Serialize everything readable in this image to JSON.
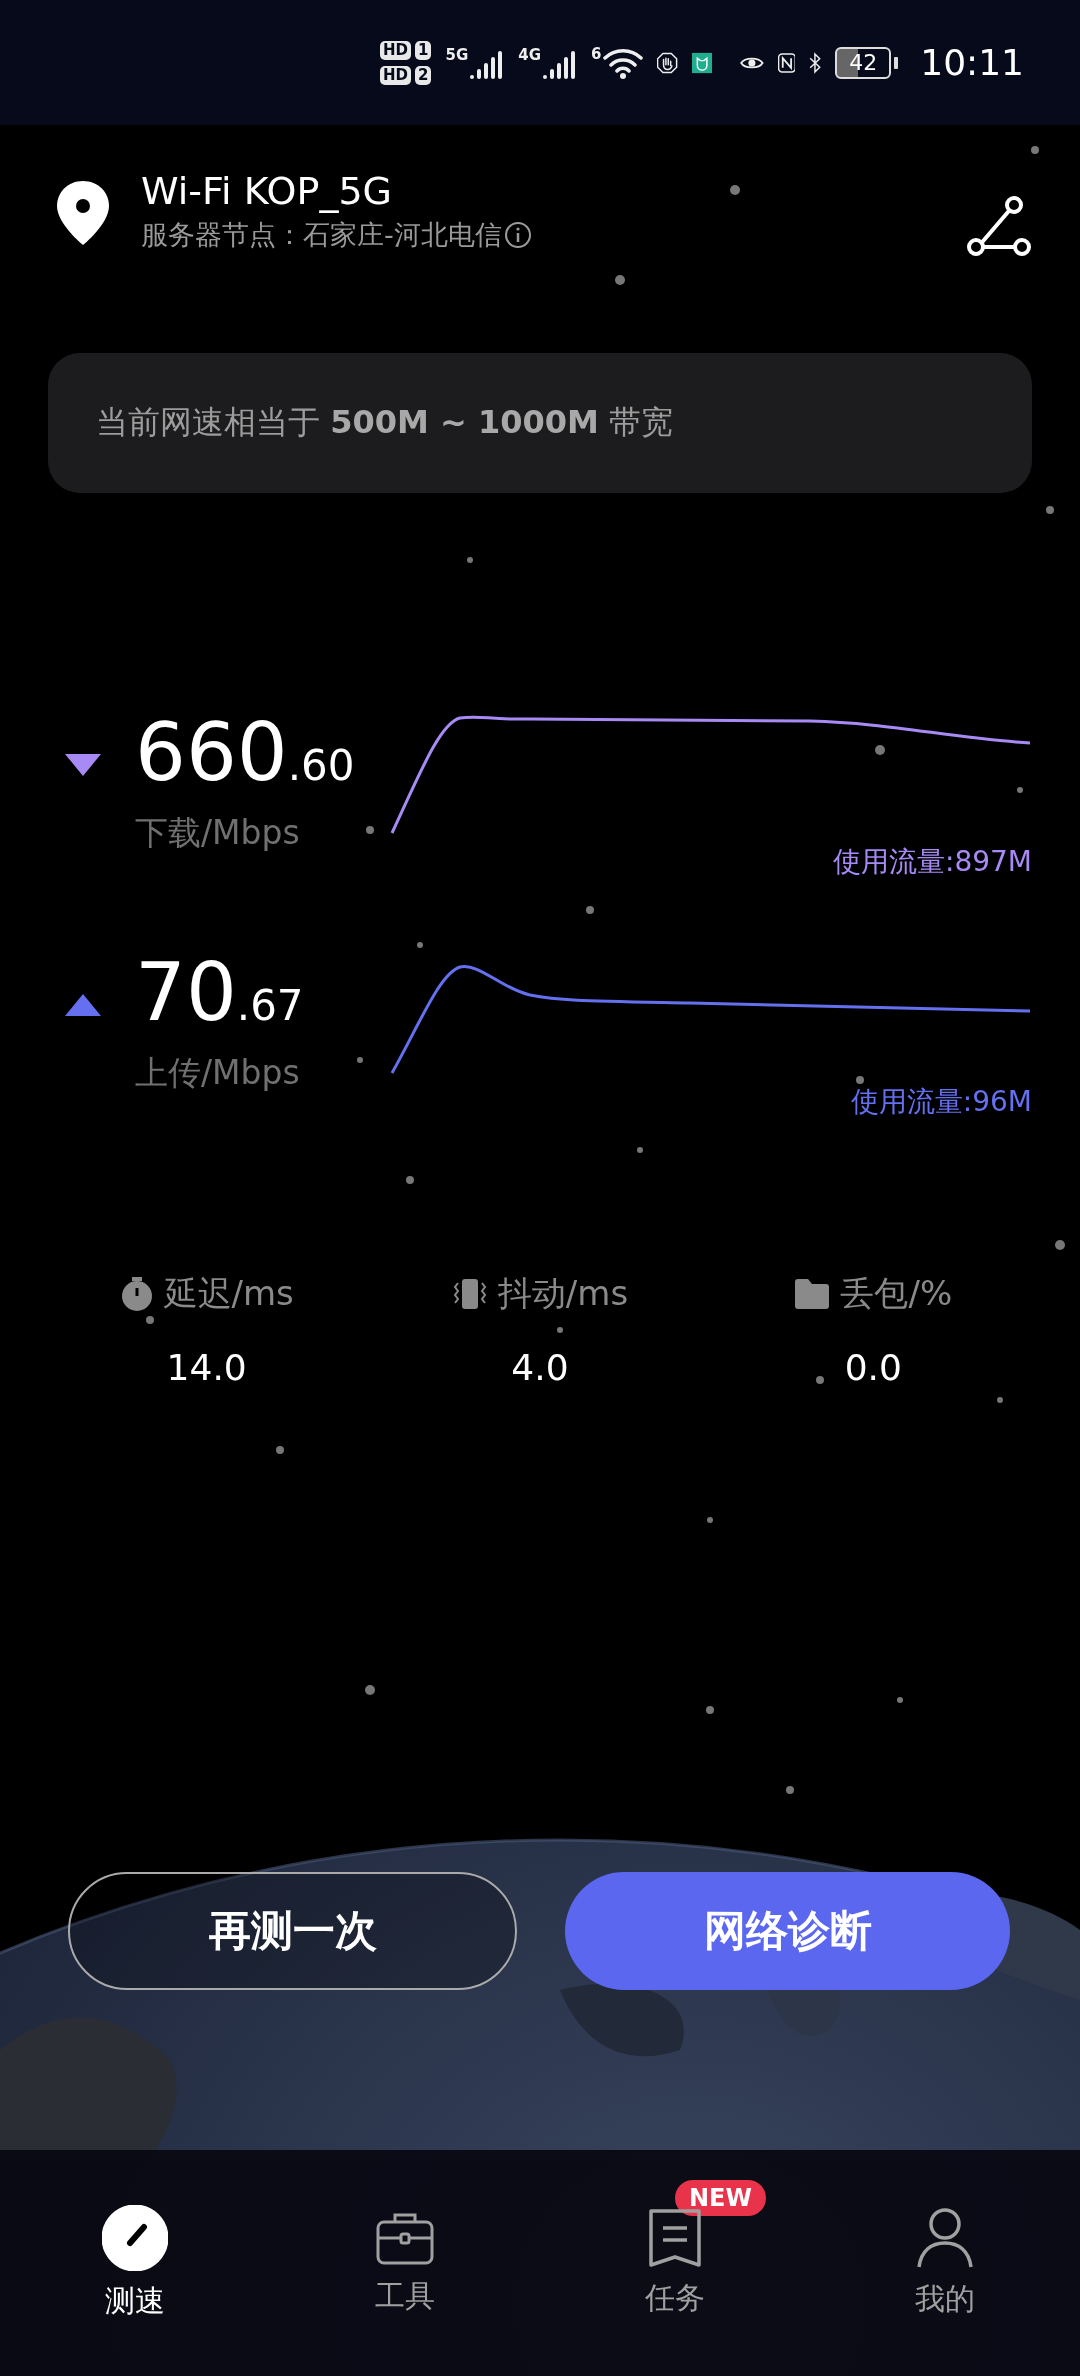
{
  "status_bar": {
    "sim_cards": [
      {
        "hd": "HD",
        "slot": "1"
      },
      {
        "hd": "HD",
        "slot": "2"
      }
    ],
    "networks": [
      "5G",
      "4G"
    ],
    "wifi_band": "6",
    "battery": "42",
    "time": "10:11"
  },
  "header": {
    "title": "Wi-Fi KOP_5G",
    "server": "服务器节点：石家庄-河北电信"
  },
  "bandwidth_note": "当前网速相当于 **500M ~ 1000M** 带宽",
  "speeds": [
    {
      "kind": "download",
      "integer": "660",
      "decimal": ".60",
      "label": "下载/Mbps",
      "usage": "使用流量:897M"
    },
    {
      "kind": "upload",
      "integer": "70",
      "decimal": ".67",
      "label": "上传/Mbps",
      "usage": "使用流量:96M"
    }
  ],
  "metrics": [
    {
      "kind": "latency",
      "label": "延迟/ms",
      "value": "14.0"
    },
    {
      "kind": "jitter",
      "label": "抖动/ms",
      "value": "4.0"
    },
    {
      "kind": "loss",
      "label": "丢包/%",
      "value": "0.0"
    }
  ],
  "buttons": [
    {
      "kind": "outline",
      "label": "再测一次"
    },
    {
      "kind": "primary",
      "label": "网络诊断"
    }
  ],
  "nav": [
    {
      "kind": "speed",
      "label": "测速",
      "selected": true
    },
    {
      "kind": "tools",
      "label": "工具",
      "selected": false
    },
    {
      "kind": "tasks",
      "label": "任务",
      "selected": false,
      "badge": "NEW"
    },
    {
      "kind": "profile",
      "label": "我的",
      "selected": false
    }
  ]
}
